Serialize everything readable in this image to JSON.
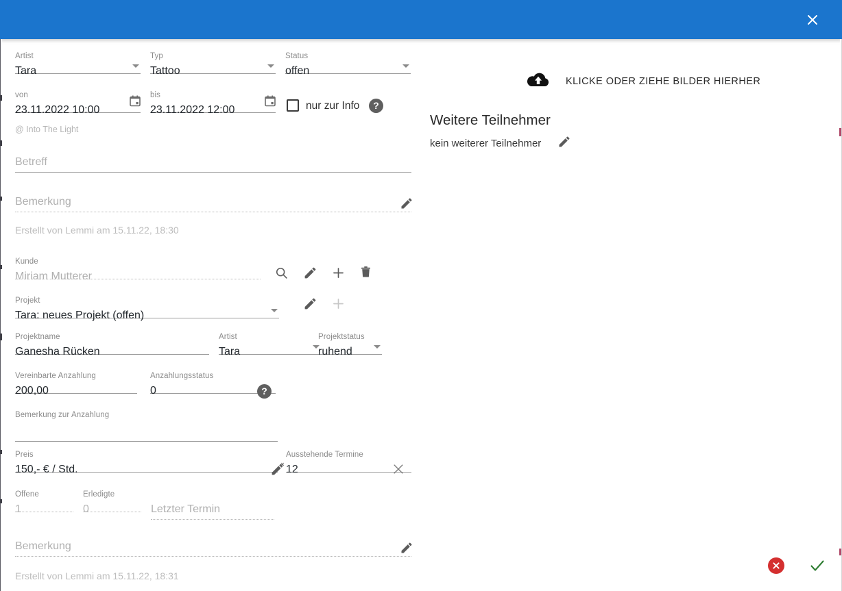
{
  "header": {
    "close_icon": "close-icon",
    "accent_color": "#1b75cd"
  },
  "appointment": {
    "artist": {
      "label": "Artist",
      "value": "Tara"
    },
    "typ": {
      "label": "Typ",
      "value": "Tattoo"
    },
    "status": {
      "label": "Status",
      "value": "offen"
    },
    "von": {
      "label": "von",
      "value": "23.11.2022 10:00"
    },
    "bis": {
      "label": "bis",
      "value": "23.11.2022 12:00"
    },
    "info_only": {
      "label": "nur zur Info",
      "checked": false
    },
    "help_icon": "?",
    "location": "@ Into The Light",
    "betreff": {
      "placeholder": "Betreff",
      "value": ""
    },
    "bemerkung": {
      "placeholder": "Bemerkung",
      "value": ""
    },
    "created": "Erstellt von Lemmi am 15.11.22, 18:30"
  },
  "customer": {
    "label": "Kunde",
    "value": "Miriam Mutterer",
    "actions": [
      "search-icon",
      "edit-icon",
      "add-icon",
      "delete-icon"
    ]
  },
  "project": {
    "label": "Projekt",
    "value": "Tara: neues Projekt (offen)",
    "actions": [
      "edit-icon",
      "add-icon"
    ],
    "name": {
      "label": "Projektname",
      "value": "Ganesha Rücken"
    },
    "artist": {
      "label": "Artist",
      "value": "Tara"
    },
    "status": {
      "label": "Projektstatus",
      "value": "ruhend"
    },
    "deposit_agreed": {
      "label": "Vereinbarte Anzahlung",
      "value": "200,00"
    },
    "deposit_status": {
      "label": "Anzahlungsstatus",
      "value": "0",
      "help_icon": "?"
    },
    "deposit_note": {
      "label": "Bemerkung zur Anzahlung",
      "value": ""
    },
    "price": {
      "label": "Preis",
      "value": "150,- € / Std."
    },
    "open_appointments": {
      "label": "Ausstehende Termine",
      "value": "12"
    },
    "offene": {
      "label": "Offene",
      "value": "1"
    },
    "erledigte": {
      "label": "Erledigte",
      "value": "0"
    },
    "last_appointment": {
      "placeholder": "Letzter Termin",
      "value": ""
    },
    "bemerkung": {
      "placeholder": "Bemerkung",
      "value": ""
    },
    "created": "Erstellt von Lemmi am 15.11.22, 18:31"
  },
  "upload": {
    "icon": "cloud-upload-icon",
    "text": "KLICKE ODER ZIEHE BILDER HIERHER"
  },
  "participants": {
    "title": "Weitere Teilnehmer",
    "empty_text": "kein weiterer Teilnehmer",
    "edit_icon": "edit-icon"
  },
  "footer": {
    "cancel_icon": "cancel-circle-icon",
    "confirm_icon": "check-icon",
    "cancel_color": "#d42f2f",
    "confirm_color": "#2e7d32"
  }
}
